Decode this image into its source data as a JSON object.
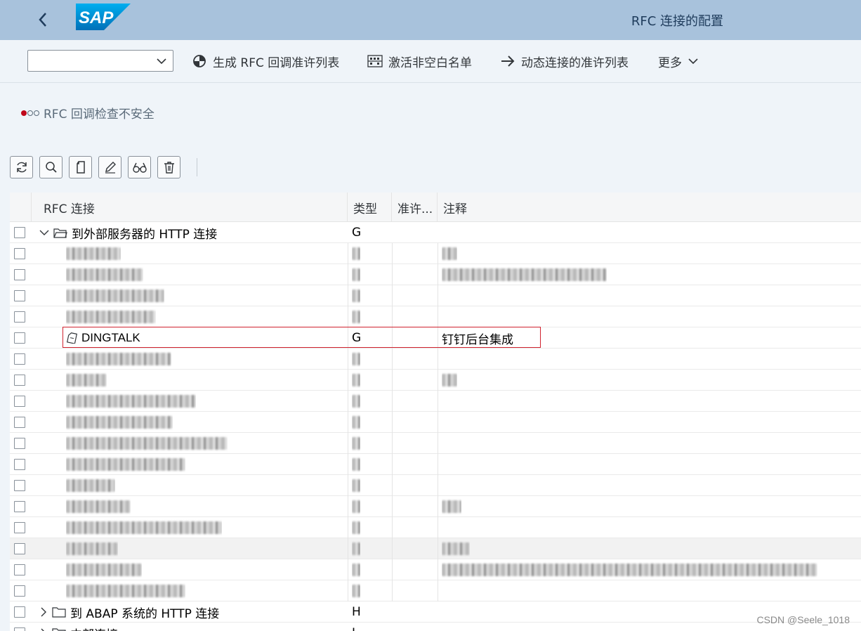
{
  "shell": {
    "title": "RFC 连接的配置"
  },
  "toolbar": {
    "dropdown_value": "",
    "generate_label": "生成 RFC 回调准许列表",
    "activate_label": "激活非空白名单",
    "dynamic_label": "动态连接的准许列表",
    "more_label": "更多"
  },
  "status": {
    "text": "RFC 回调检查不安全",
    "lights": [
      "#c0081b",
      "#ffffff",
      "#ffffff"
    ]
  },
  "table": {
    "headers": [
      "RFC 连接",
      "类型",
      "准许...",
      "注释"
    ],
    "group1": {
      "label": "到外部服务器的 HTTP 连接",
      "type": "G"
    },
    "rows": [
      {
        "name": "",
        "type": "",
        "note": "",
        "blur_name": 78,
        "blur_note": 22
      },
      {
        "name": "",
        "type": "",
        "note": "",
        "blur_name": 110,
        "blur_note": 235
      },
      {
        "name": "",
        "type": "",
        "note": "",
        "blur_name": 140,
        "blur_note": 0
      },
      {
        "name": "",
        "type": "",
        "note": "",
        "blur_name": 128,
        "blur_note": 0
      },
      {
        "name": "DINGTALK",
        "type": "G",
        "note": "钉钉后台集成",
        "blur_name": 0,
        "blur_note": 0
      },
      {
        "name": "",
        "type": "",
        "note": "",
        "blur_name": 150,
        "blur_note": 0
      },
      {
        "name": "",
        "type": "",
        "note": "",
        "blur_name": 58,
        "blur_note": 22
      },
      {
        "name": "",
        "type": "",
        "note": "",
        "blur_name": 185,
        "blur_note": 0
      },
      {
        "name": "",
        "type": "",
        "note": "",
        "blur_name": 152,
        "blur_note": 0
      },
      {
        "name": "",
        "type": "",
        "note": "",
        "blur_name": 230,
        "blur_note": 0
      },
      {
        "name": "",
        "type": "",
        "note": "",
        "blur_name": 170,
        "blur_note": 0
      },
      {
        "name": "",
        "type": "",
        "note": "",
        "blur_name": 70,
        "blur_note": 0
      },
      {
        "name": "",
        "type": "",
        "note": "",
        "blur_name": 92,
        "blur_note": 28
      },
      {
        "name": "",
        "type": "",
        "note": "",
        "blur_name": 222,
        "blur_note": 0
      },
      {
        "name": "",
        "type": "",
        "note": "",
        "blur_name": 74,
        "blur_note": 40
      },
      {
        "name": "",
        "type": "",
        "note": "",
        "blur_name": 108,
        "blur_note": 535
      },
      {
        "name": "",
        "type": "",
        "note": "",
        "blur_name": 170,
        "blur_note": 0
      }
    ],
    "group2": {
      "label": "到 ABAP 系统的 HTTP 连接",
      "type": "H"
    },
    "group3": {
      "label": "内部连接",
      "type": "I"
    }
  },
  "watermark": "CSDN @Seele_1018"
}
